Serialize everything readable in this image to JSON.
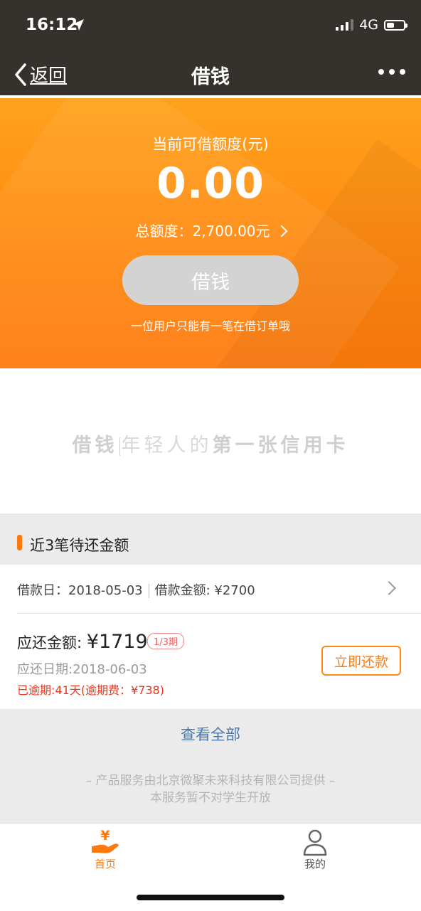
{
  "status_bar": {
    "time": "16:12",
    "network": "4G",
    "battery_level": 0.45
  },
  "nav": {
    "back_label": "返回",
    "title": "借钱"
  },
  "hero": {
    "available_label": "当前可借额度(元)",
    "available_amount": "0.00",
    "total_label": "总额度：2,700.00元",
    "borrow_button": "借钱",
    "note": "一位用户只能有一笔在借订单哦"
  },
  "slogan": {
    "brand": "借钱",
    "part1": "年轻人的",
    "part2": "第一张信用卡"
  },
  "pending": {
    "section_title": "近3笔待还金额",
    "loan_date": "借款日：2018-05-03",
    "loan_amount": "借款金额: ¥2700",
    "due_label": "应还金额: ",
    "due_amount": "¥1719",
    "period": "1/3期",
    "due_date": "应还日期:2018-06-03",
    "overdue": "已逾期:41天(逾期费：¥738)",
    "repay_button": "立即还款"
  },
  "footer": {
    "view_all": "查看全部",
    "provider": "– 产品服务由北京微聚未来科技有限公司提供 –",
    "student_notice": "本服务暂不对学生开放"
  },
  "tabs": [
    {
      "label": "首页",
      "icon": "yen-hand-icon",
      "active": true
    },
    {
      "label": "我的",
      "icon": "user-icon",
      "active": false
    }
  ],
  "colors": {
    "accent": "#ff7a0c",
    "header_bg": "#35312c",
    "overdue_red": "#e8371e",
    "link_blue": "#4a78ad"
  }
}
